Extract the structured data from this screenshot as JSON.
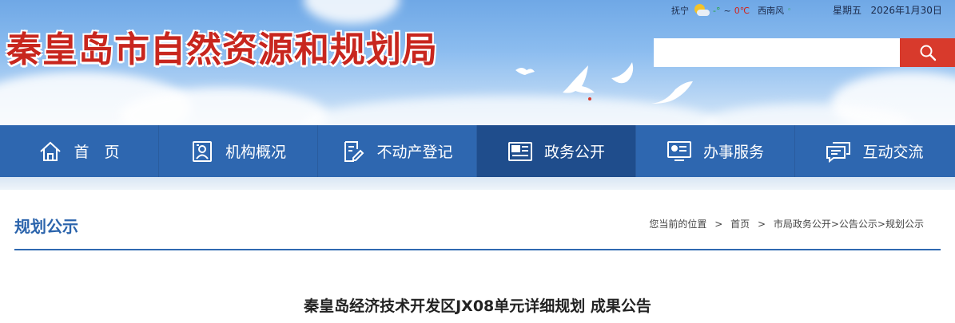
{
  "header": {
    "site_title": "秦皇岛市自然资源和规划局",
    "weather": {
      "city": "抚宁",
      "icon": "partly-cloudy-icon",
      "temp_low": "-°",
      "temp_sep": "~",
      "temp_high": "0℃",
      "wind": "西南风"
    },
    "weekday": "星期五",
    "date": "2026年1月30日",
    "search": {
      "placeholder": ""
    }
  },
  "nav": {
    "items": [
      {
        "label": "首　页",
        "icon": "home-icon"
      },
      {
        "label": "机构概况",
        "icon": "org-icon"
      },
      {
        "label": "不动产登记",
        "icon": "register-icon"
      },
      {
        "label": "政务公开",
        "icon": "document-icon"
      },
      {
        "label": "办事服务",
        "icon": "service-icon"
      },
      {
        "label": "互动交流",
        "icon": "chat-icon"
      }
    ],
    "active_index": 3
  },
  "content": {
    "section_title": "规划公示",
    "breadcrumb": {
      "prefix": "您当前的位置",
      "items": [
        "首页",
        "市局政务公开>公告公示>规划公示"
      ],
      "sep": ">"
    },
    "article_title": "秦皇岛经济技术开发区JX08单元详细规划 成果公告"
  },
  "colors": {
    "nav": "#2e67b0",
    "nav_active": "#1f4d8c",
    "title_red": "#c8261e",
    "accent_blue": "#2b64ac",
    "search_red": "#d83a2c"
  }
}
